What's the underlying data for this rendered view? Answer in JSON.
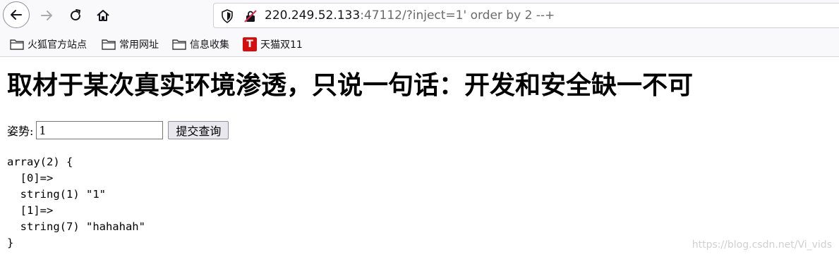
{
  "browser": {
    "url_host": "220.249.52.133",
    "url_rest": ":47112/?inject=1' order by 2 --+"
  },
  "bookmarks": [
    {
      "label": "火狐官方站点",
      "icon": "folder-icon"
    },
    {
      "label": "常用网址",
      "icon": "folder-icon"
    },
    {
      "label": "信息收集",
      "icon": "folder-icon"
    },
    {
      "label": "天猫双11",
      "icon": "tmall-icon",
      "icon_glyph": "T"
    }
  ],
  "page": {
    "heading": "取材于某次真实环境渗透，只说一句话：开发和安全缺一不可",
    "form_label": "姿势:",
    "input_value": "1",
    "submit_label": "提交查询",
    "output_lines": [
      "array(2) {",
      "  [0]=>",
      "  string(1) \"1\"",
      "  [1]=>",
      "  string(7) \"hahahah\"",
      "}"
    ]
  },
  "watermark": "https://blog.csdn.net/Vi_vids",
  "colors": {
    "toolbar_bg": "#f9f9fb",
    "tmall_red": "#d60d0d"
  }
}
